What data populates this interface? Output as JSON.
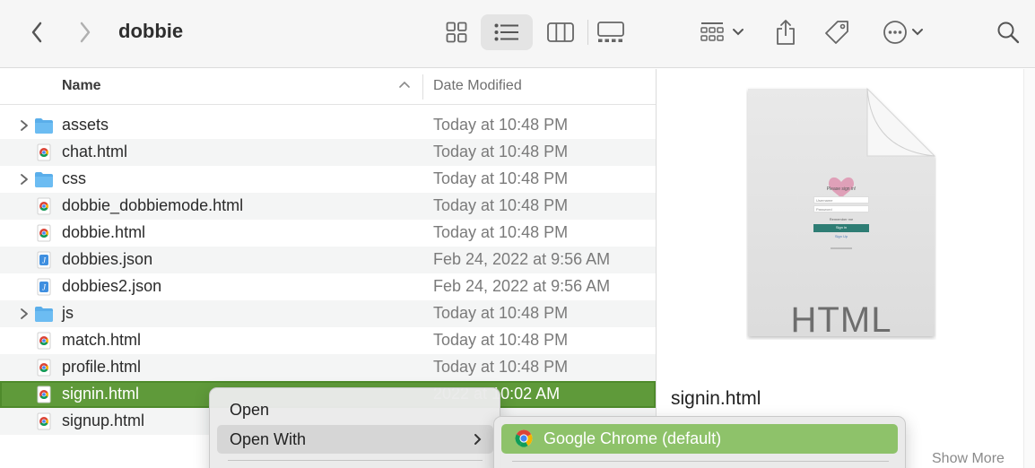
{
  "window": {
    "title": "dobbie"
  },
  "toolbar": {
    "back_icon": "chevron-left-icon",
    "forward_icon": "chevron-right-icon",
    "views": [
      "icon-view",
      "list-view",
      "column-view",
      "gallery-view"
    ],
    "active_view": "list-view"
  },
  "columns": {
    "name": "Name",
    "date": "Date Modified"
  },
  "files": [
    {
      "name": "assets",
      "date": "Today at 10:48 PM",
      "kind": "folder"
    },
    {
      "name": "chat.html",
      "date": "Today at 10:48 PM",
      "kind": "chrome-html"
    },
    {
      "name": "css",
      "date": "Today at 10:48 PM",
      "kind": "folder"
    },
    {
      "name": "dobbie_dobbiemode.html",
      "date": "Today at 10:48 PM",
      "kind": "chrome-html"
    },
    {
      "name": "dobbie.html",
      "date": "Today at 10:48 PM",
      "kind": "chrome-html"
    },
    {
      "name": "dobbies.json",
      "date": "Feb 24, 2022 at 9:56 AM",
      "kind": "json"
    },
    {
      "name": "dobbies2.json",
      "date": "Feb 24, 2022 at 9:56 AM",
      "kind": "json"
    },
    {
      "name": "js",
      "date": "Today at 10:48 PM",
      "kind": "folder"
    },
    {
      "name": "match.html",
      "date": "Today at 10:48 PM",
      "kind": "chrome-html"
    },
    {
      "name": "profile.html",
      "date": "Today at 10:48 PM",
      "kind": "chrome-html"
    },
    {
      "name": "signin.html",
      "date": "2022 at 10:02 AM",
      "kind": "chrome-html",
      "selected": true
    },
    {
      "name": "signup.html",
      "date": "",
      "kind": "chrome-html"
    }
  ],
  "preview": {
    "doc_type": "HTML",
    "thumb_title": "Please sign in!",
    "thumb_username": "Username",
    "thumb_password": "Password",
    "thumb_remember": "Remember me",
    "thumb_signin": "Sign in",
    "thumb_signup": "Sign Up",
    "file_name": "signin.html",
    "show_more": "Show More"
  },
  "context_menu": {
    "items": [
      "Open",
      "Open With"
    ]
  },
  "submenu": {
    "items": [
      "Google Chrome (default)"
    ]
  },
  "colors": {
    "selection": "#5f9a3a",
    "submenu_highlight": "#8ec26a",
    "folder": "#5aaeea"
  }
}
